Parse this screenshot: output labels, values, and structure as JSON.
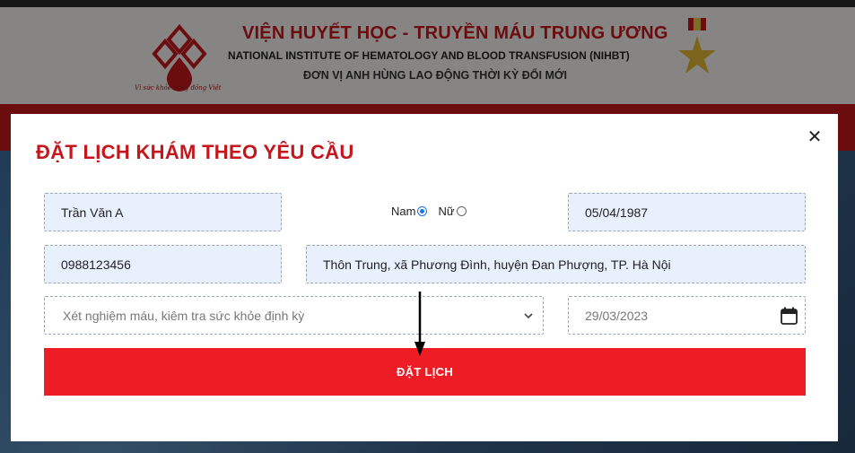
{
  "site": {
    "institute_vi": "VIỆN HUYẾT HỌC - TRUYỀN MÁU TRUNG ƯƠNG",
    "institute_en": "NATIONAL INSTITUTE OF HEMATOLOGY AND BLOOD TRANSFUSION (NIHBT)",
    "hero_title": "ĐƠN VỊ ANH HÙNG LAO ĐỘNG THỜI KỲ ĐỔI MỚI",
    "slogan": "Vì sức khỏe cộng đồng Việt",
    "brand_color": "#c4161c"
  },
  "modal": {
    "title": "ĐẶT LỊCH KHÁM THEO YÊU CẦU",
    "close_icon": "close-icon",
    "fields": {
      "name_value": "Trần Văn A",
      "dob_value": "05/04/1987",
      "phone_value": "0988123456",
      "address_value": "Thôn Trung, xã Phương Đình, huyện Đan Phượng, TP. Hà Nội",
      "service_value": "Xét nghiệm máu, kiêm tra sức khỏe định kỳ",
      "date_value": "29/03/2023"
    },
    "gender": {
      "male_label": "Nam",
      "female_label": "Nữ",
      "selected": "Nam"
    },
    "submit_label": "ĐẶT LỊCH",
    "submit_color": "#ee1c25"
  }
}
